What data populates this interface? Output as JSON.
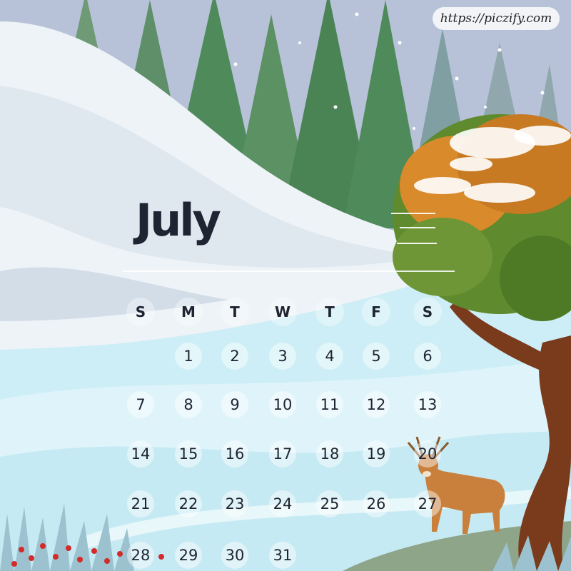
{
  "calendar": {
    "month": "July",
    "weekdays": [
      "S",
      "M",
      "T",
      "W",
      "T",
      "F",
      "S"
    ],
    "weeks": [
      [
        "",
        "1",
        "2",
        "3",
        "4",
        "5",
        "6"
      ],
      [
        "7",
        "8",
        "9",
        "10",
        "11",
        "12",
        "13"
      ],
      [
        "14",
        "15",
        "16",
        "17",
        "18",
        "19",
        "20"
      ],
      [
        "21",
        "22",
        "23",
        "24",
        "25",
        "26",
        "27"
      ],
      [
        "28",
        "29",
        "30",
        "31",
        "",
        "",
        ""
      ]
    ]
  },
  "watermark": {
    "text": "https://piczify.com"
  },
  "illustration": {
    "elements": [
      "snowy-hill",
      "pine-forest",
      "autumn-tree",
      "deer",
      "frosted-grass",
      "red-berries",
      "falling-snow"
    ],
    "colors": {
      "sky": "#b7c2d9",
      "snow": "#eef3f8",
      "ice": "#cdeef6",
      "pine": "#4f8a5b",
      "foliage": "#d98a2b",
      "trunk": "#7a3a1c",
      "deer": "#c9803d",
      "text": "#1f2432"
    }
  }
}
